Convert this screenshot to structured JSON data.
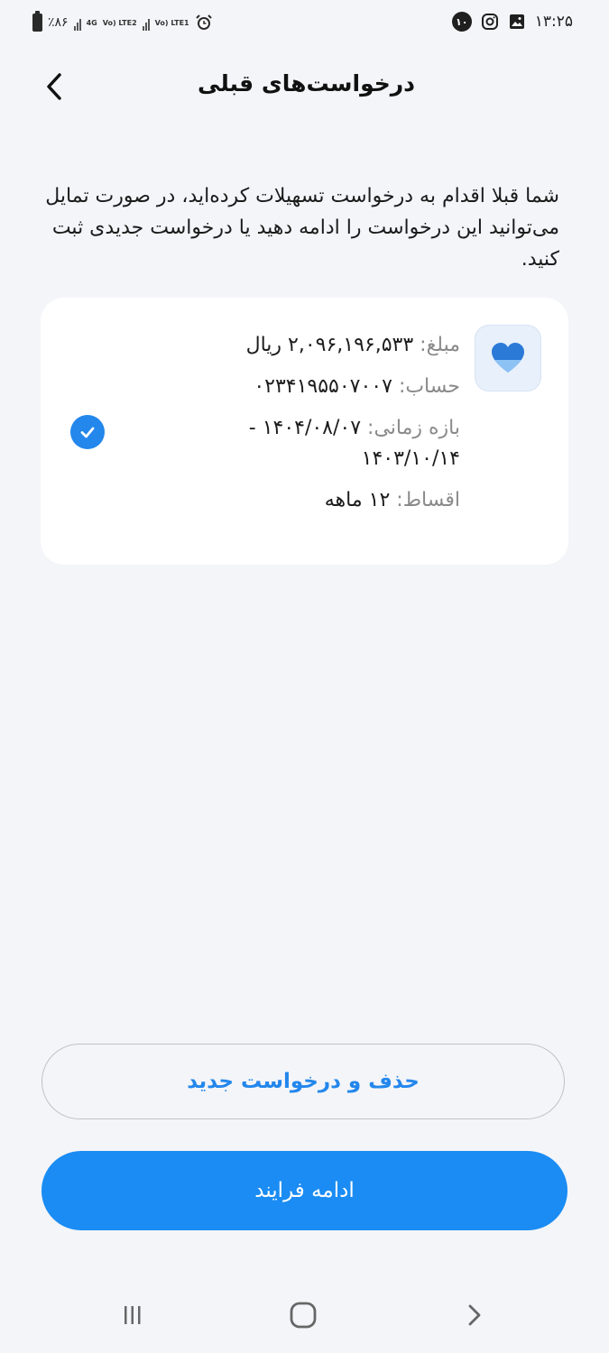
{
  "status_bar": {
    "time": "۱۳:۲۵",
    "notification_count": "۱۰",
    "battery": "٪۸۶",
    "network1_top": "4G",
    "network1_bottom": "Vo) LTE2",
    "network2": "Vo) LTE1",
    "icons": [
      "instagram-icon",
      "gallery-icon",
      "alarm-icon",
      "battery-icon",
      "signal-icon"
    ]
  },
  "header": {
    "title": "درخواست‌های قبلی",
    "back_icon": "chevron-left-icon"
  },
  "description": "شما قبلا اقدام به درخواست تسهیلات کرده‌اید، در صورت تمایل می‌توانید این درخواست را ادامه دهید یا درخواست جدیدی ثبت کنید.",
  "card": {
    "icon": "heart-icon",
    "amount_label": "مبلغ:",
    "amount_value": "۲,۰۹۶,۱۹۶,۵۳۳ ریال",
    "account_label": "حساب:",
    "account_value": "۰۲۳۴۱۹۵۵۰۷۰۰۷",
    "period_label": "بازه زمانی:",
    "period_value": "۱۴۰۴/۰۸/۰۷ - ۱۴۰۳/۱۰/۱۴",
    "installments_label": "اقساط:",
    "installments_value": "۱۲ ماهه",
    "selected": true
  },
  "buttons": {
    "delete_new": "حذف و درخواست جدید",
    "continue": "ادامه فرایند"
  },
  "colors": {
    "accent": "#1a8cf3",
    "background": "#f4f5f9",
    "card": "#ffffff"
  },
  "nav_bar": {
    "icons": [
      "recent-apps-icon",
      "home-icon",
      "back-icon"
    ]
  }
}
